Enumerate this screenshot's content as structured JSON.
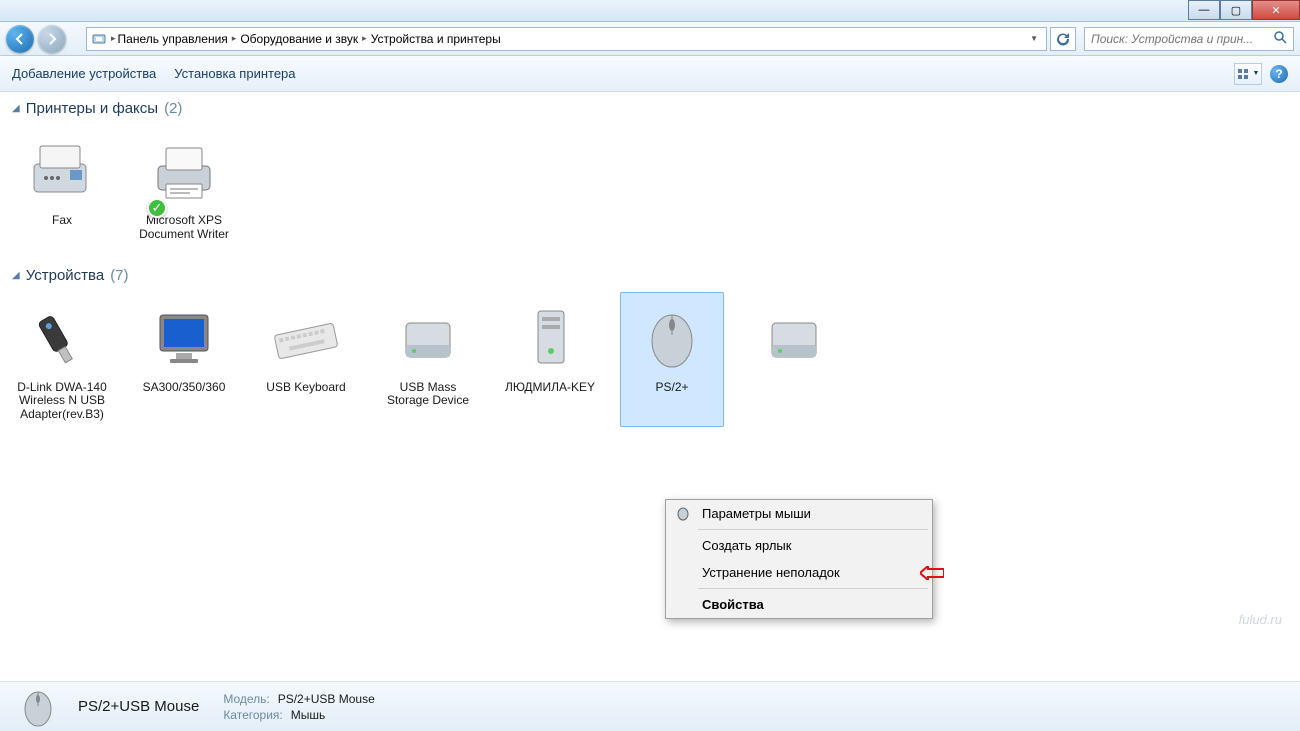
{
  "window": {
    "minimize": "—",
    "maximize": "▢",
    "close": "✕"
  },
  "breadcrumb": {
    "seg1": "Панель управления",
    "seg2": "Оборудование и звук",
    "seg3": "Устройства и принтеры"
  },
  "search": {
    "placeholder": "Поиск: Устройства и прин..."
  },
  "toolbar": {
    "add_device": "Добавление устройства",
    "add_printer": "Установка принтера"
  },
  "groups": {
    "printers": {
      "name": "Принтеры и факсы",
      "count": "(2)"
    },
    "devices": {
      "name": "Устройства",
      "count": "(7)"
    }
  },
  "printers": [
    {
      "label": "Fax"
    },
    {
      "label": "Microsoft XPS Document Writer"
    }
  ],
  "devices": [
    {
      "label": "D-Link DWA-140 Wireless N USB Adapter(rev.B3)"
    },
    {
      "label": "SA300/350/360"
    },
    {
      "label": "USB Keyboard"
    },
    {
      "label": "USB Mass Storage Device"
    },
    {
      "label": "ЛЮДМИЛА-KEY"
    },
    {
      "label": "PS/2+"
    },
    {
      "label": ""
    }
  ],
  "context_menu": {
    "item1": "Параметры мыши",
    "item2": "Создать ярлык",
    "item3": "Устранение неполадок",
    "item4": "Свойства"
  },
  "status": {
    "title": "PS/2+USB Mouse",
    "model_label": "Модель:",
    "model_value": "PS/2+USB Mouse",
    "cat_label": "Категория:",
    "cat_value": "Мышь"
  },
  "watermark": "fulud.ru"
}
